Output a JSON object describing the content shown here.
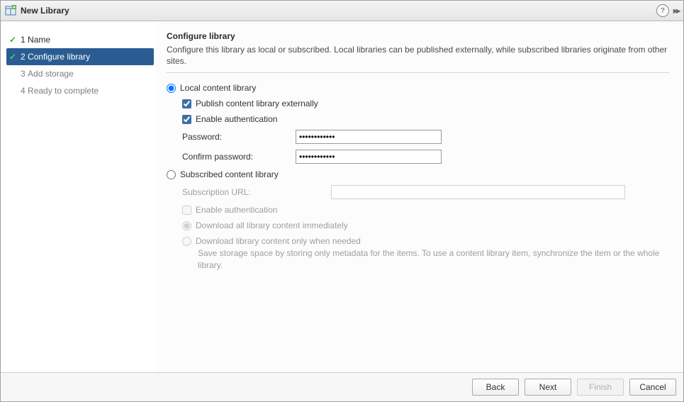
{
  "title": "New Library",
  "steps": [
    {
      "num": "1",
      "label": "Name",
      "completed": true,
      "active": false
    },
    {
      "num": "2",
      "label": "Configure library",
      "completed": true,
      "active": true
    },
    {
      "num": "3",
      "label": "Add storage",
      "completed": false,
      "active": false
    },
    {
      "num": "4",
      "label": "Ready to complete",
      "completed": false,
      "active": false
    }
  ],
  "section": {
    "heading": "Configure library",
    "subtext": "Configure this library as local or subscribed. Local libraries can be published externally, while subscribed libraries originate from other sites."
  },
  "form": {
    "local_label": "Local content library",
    "publish_label": "Publish content library externally",
    "enable_auth_label": "Enable authentication",
    "password_label": "Password:",
    "password_value": "************",
    "confirm_label": "Confirm password:",
    "confirm_value": "************",
    "subscribed_label": "Subscribed content library",
    "subscription_url_label": "Subscription URL:",
    "subscription_url_value": "",
    "sub_enable_auth_label": "Enable authentication",
    "sub_download_all_label": "Download all library content immediately",
    "sub_download_ondemand_label": "Download library content only when needed",
    "sub_hint": "Save storage space by storing only metadata for the items. To use a content library item, synchronize the item or the whole library."
  },
  "footer": {
    "back": "Back",
    "next": "Next",
    "finish": "Finish",
    "cancel": "Cancel"
  }
}
